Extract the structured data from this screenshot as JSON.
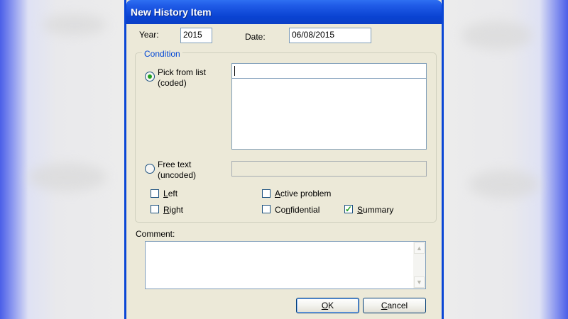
{
  "window": {
    "title": "New History Item"
  },
  "form": {
    "year_label": "Year:",
    "year_value": "2015",
    "date_label": "Date:",
    "date_value": "06/08/2015",
    "condition_legend": "Condition",
    "pick_line1": "Pick from list",
    "pick_line2": "(coded)",
    "free_line1": "Free text",
    "free_line2": "(uncoded)",
    "left_label": "Left",
    "right_label": "Right",
    "active_label": "Active problem",
    "confidential_label": "Confidential",
    "summary_label": "Summary",
    "comment_label": "Comment:",
    "pick_selected": true,
    "summary_checked": true
  },
  "buttons": {
    "ok": "OK",
    "cancel": "Cancel"
  },
  "icons": {
    "scroll_up": "up-arrow-icon",
    "scroll_down": "down-arrow-icon",
    "check": "check-icon"
  },
  "colors": {
    "titlebar": "#0a43d2",
    "legend": "#0046d5",
    "checked": "#21a121"
  }
}
